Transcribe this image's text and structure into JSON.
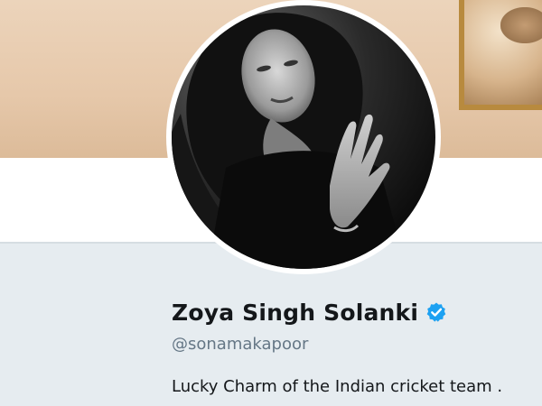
{
  "profile": {
    "display_name": "Zoya Singh Solanki",
    "handle": "@sonamakapoor",
    "bio": "Lucky Charm of the Indian cricket team .",
    "verified": true,
    "verified_icon": "verified-badge-icon"
  },
  "colors": {
    "verified_blue": "#1da1f2",
    "name_text": "#14171a",
    "handle_text": "#657786",
    "card_background": "#e6ecf0",
    "banner_tone": "#e6c8aa"
  }
}
